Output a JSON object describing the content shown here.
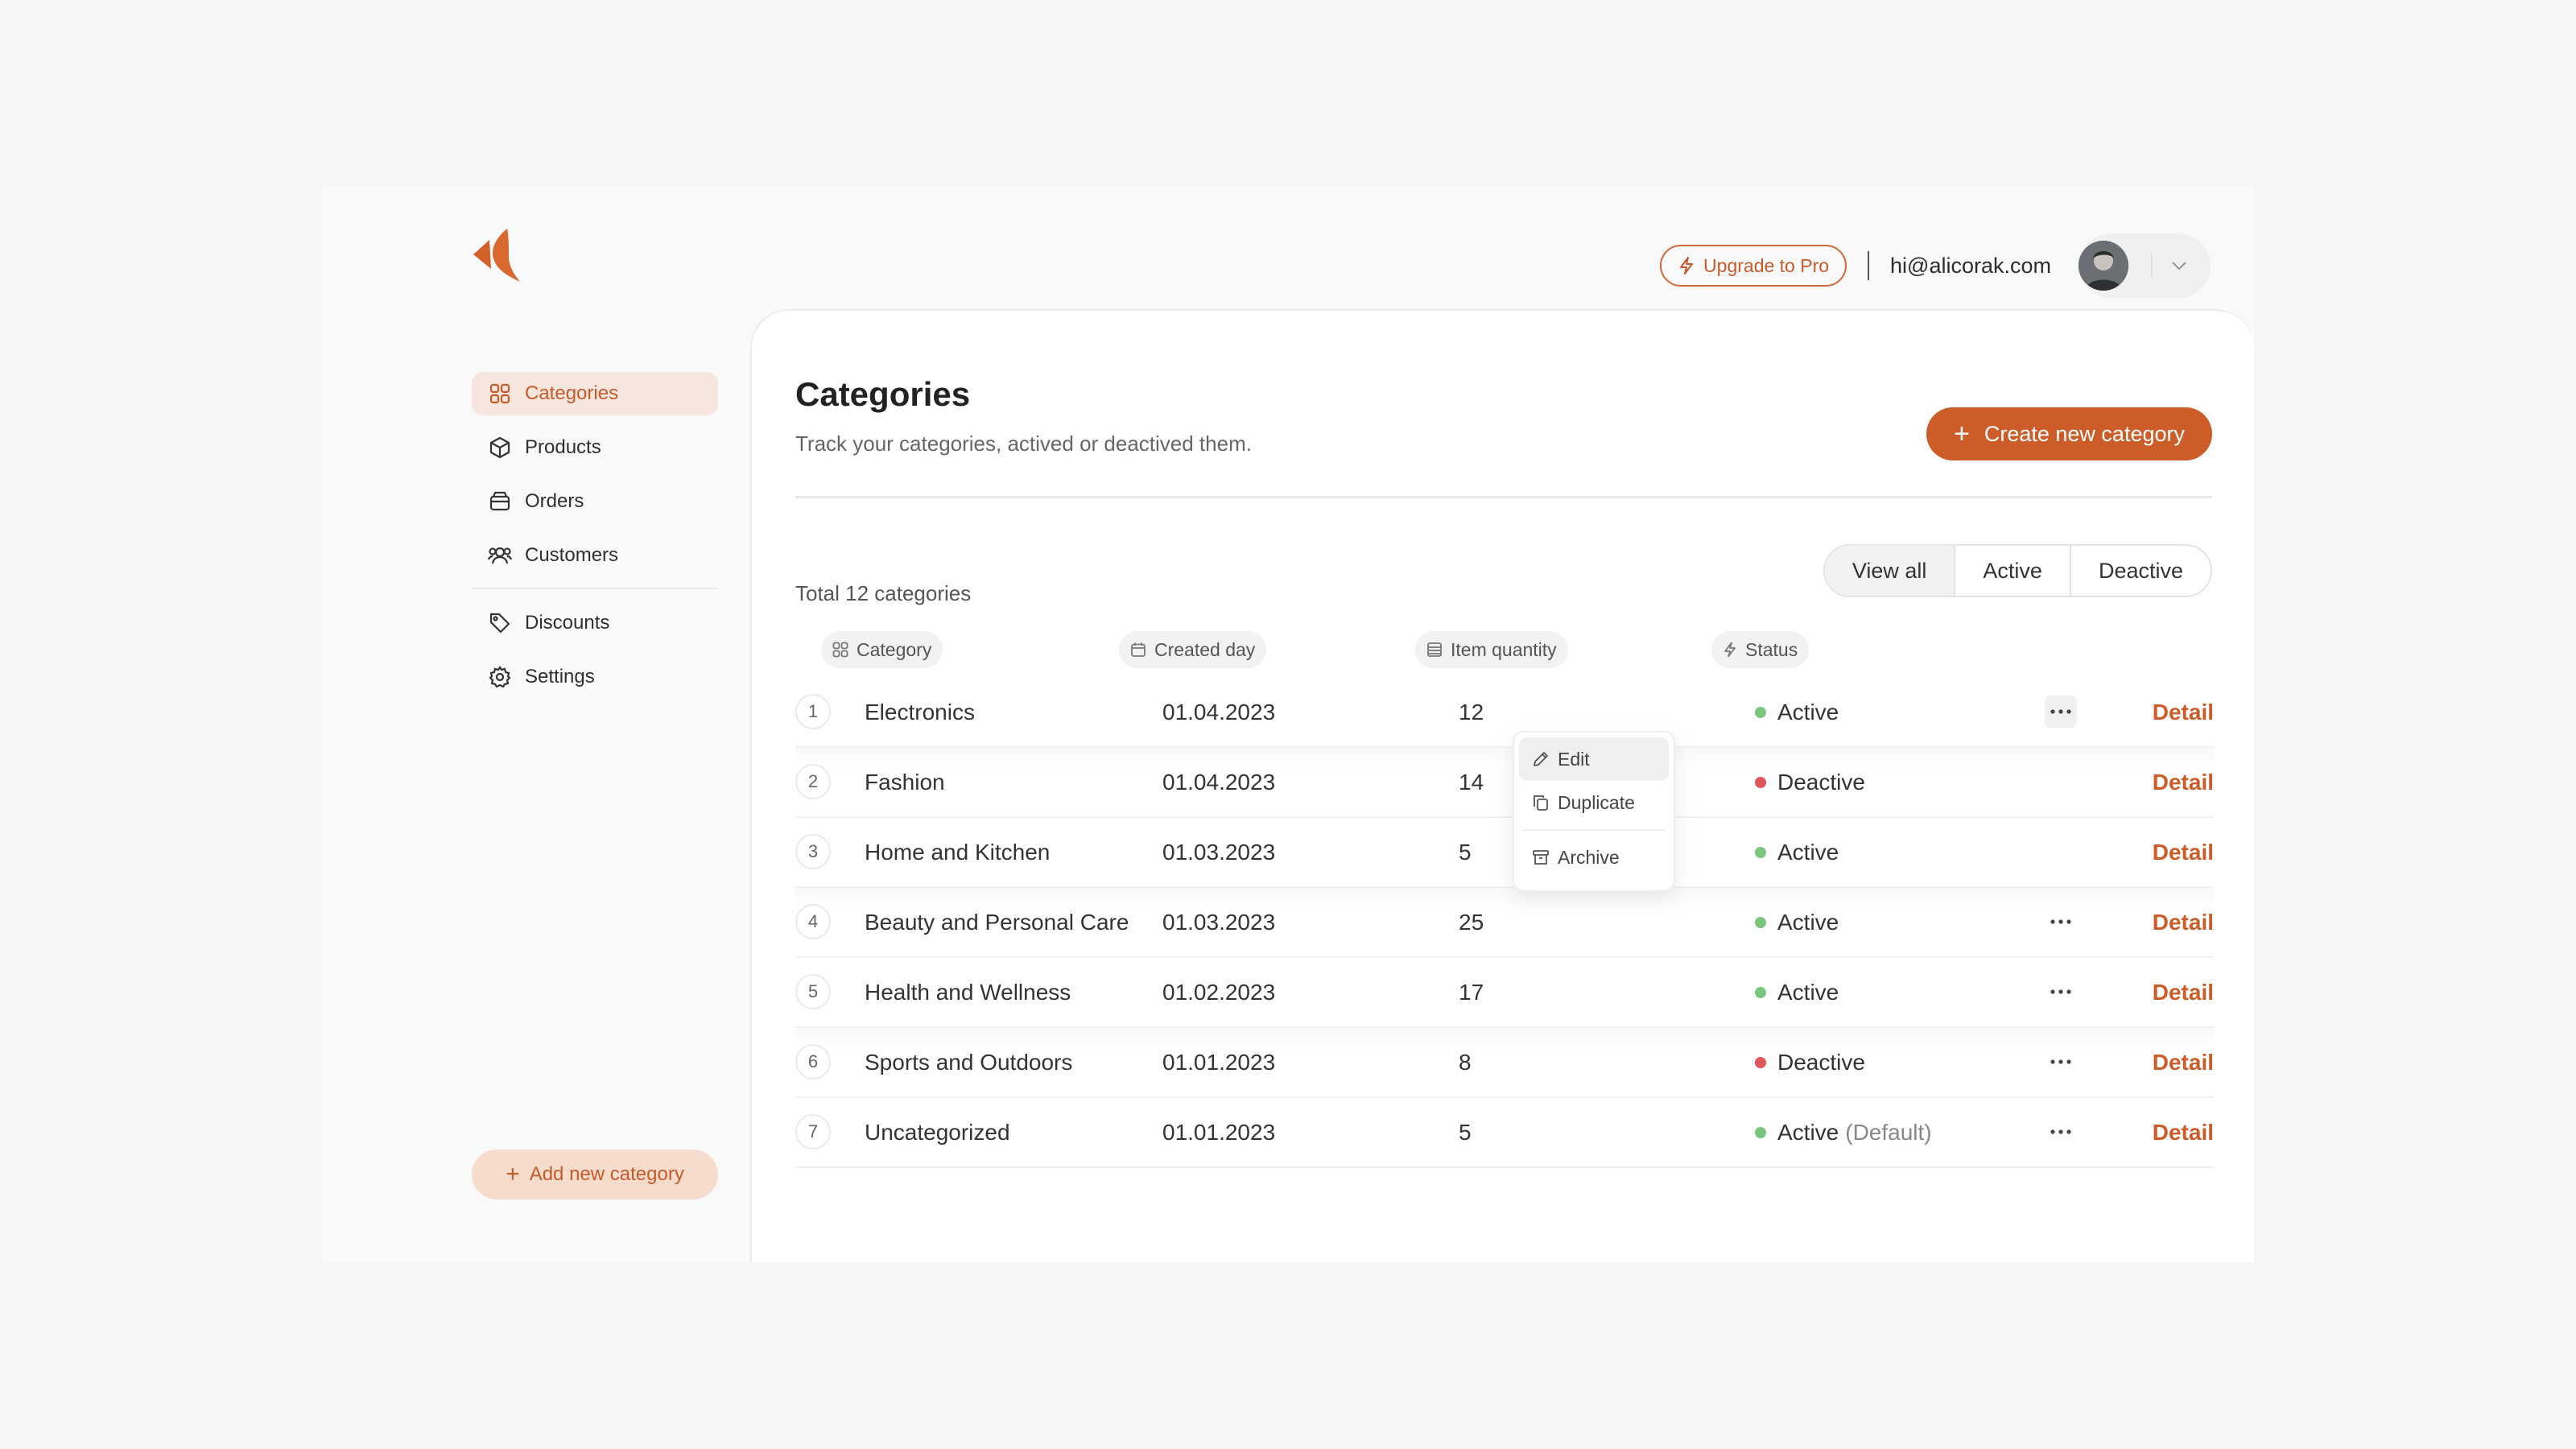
{
  "colors": {
    "accent": "#cc5c28",
    "active_dot": "#7bc67e",
    "deactive_dot": "#e0575b"
  },
  "header": {
    "upgrade_label": "Upgrade to Pro",
    "email": "hi@alicorak.com"
  },
  "sidebar": {
    "items": [
      {
        "label": "Categories",
        "icon": "grid-icon",
        "active": true
      },
      {
        "label": "Products",
        "icon": "box-icon"
      },
      {
        "label": "Orders",
        "icon": "archive-box-icon"
      },
      {
        "label": "Customers",
        "icon": "users-icon"
      },
      {
        "label": "Discounts",
        "icon": "tag-icon"
      },
      {
        "label": "Settings",
        "icon": "gear-icon"
      }
    ],
    "add_button_label": "Add new category"
  },
  "main": {
    "title": "Categories",
    "subtitle": "Track your categories, actived or deactived them.",
    "create_button_label": "Create new category",
    "total_text": "Total 12 categories",
    "filters": [
      "View all",
      "Active",
      "Deactive"
    ],
    "columns": {
      "category": "Category",
      "created": "Created day",
      "quantity": "Item quantity",
      "status": "Status"
    },
    "detail_label": "Detail",
    "rows": [
      {
        "n": "1",
        "category": "Electronics",
        "created": "01.04.2023",
        "quantity": "12",
        "status": "Active",
        "extra": ""
      },
      {
        "n": "2",
        "category": "Fashion",
        "created": "01.04.2023",
        "quantity": "14",
        "status": "Deactive",
        "extra": ""
      },
      {
        "n": "3",
        "category": "Home and Kitchen",
        "created": "01.03.2023",
        "quantity": "5",
        "status": "Active",
        "extra": ""
      },
      {
        "n": "4",
        "category": "Beauty and Personal Care",
        "created": "01.03.2023",
        "quantity": "25",
        "status": "Active",
        "extra": ""
      },
      {
        "n": "5",
        "category": "Health and Wellness",
        "created": "01.02.2023",
        "quantity": "17",
        "status": "Active",
        "extra": ""
      },
      {
        "n": "6",
        "category": "Sports and Outdoors",
        "created": "01.01.2023",
        "quantity": "8",
        "status": "Deactive",
        "extra": ""
      },
      {
        "n": "7",
        "category": "Uncategorized",
        "created": "01.01.2023",
        "quantity": "5",
        "status": "Active",
        "extra": "(Default)"
      }
    ],
    "context_menu": {
      "edit": "Edit",
      "duplicate": "Duplicate",
      "archive": "Archive"
    }
  }
}
